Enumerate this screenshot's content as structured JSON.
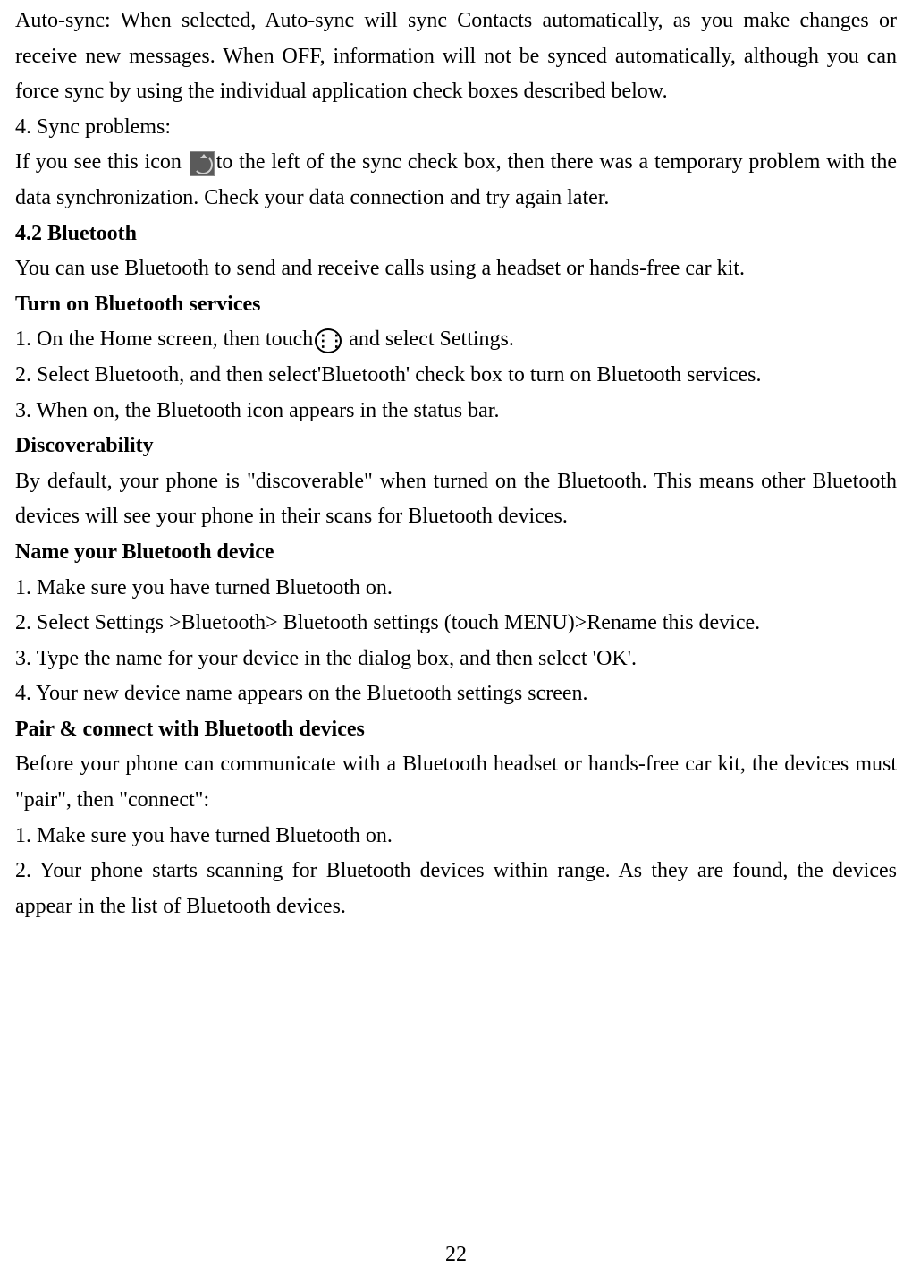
{
  "p1": "Auto-sync: When selected, Auto-sync will sync Contacts automatically, as you make changes or receive new messages. When OFF, information will not be synced automatically, although you can force sync by using the individual application check boxes described below.",
  "p2": "4. Sync problems:",
  "p3a": "If you see this icon ",
  "p3b": "to the left of the sync check box, then there was a temporary problem with the data synchronization. Check your data connection and try again later.",
  "h42": "4.2 Bluetooth",
  "p4": "You can use Bluetooth to send and receive calls using a headset or hands-free car kit.",
  "h_turn": "Turn on Bluetooth services",
  "p5a": "1. On the Home screen, then touch",
  "p5b": " and select Settings.",
  "p6": "2. Select Bluetooth, and then select'Bluetooth' check box to turn on Bluetooth services.",
  "p7": "3. When on, the Bluetooth icon appears in the status bar.",
  "h_disc": "Discoverability",
  "p8": "By default, your phone is \"discoverable\" when turned on the Bluetooth. This means other Bluetooth devices will see your phone in their scans for Bluetooth devices.",
  "h_name": "Name your Bluetooth device",
  "p9": "1. Make sure you have turned Bluetooth on.",
  "p10": "2. Select Settings >Bluetooth> Bluetooth settings (touch MENU)>Rename this device.",
  "p11": "3. Type the name for your device in the dialog box, and then select 'OK'.",
  "p12": "4. Your new device name appears on the Bluetooth settings screen.",
  "h_pair": "Pair & connect with Bluetooth devices",
  "p13": "Before your phone can communicate with a Bluetooth headset or hands-free car kit, the devices must \"pair\", then \"connect\":",
  "p14": "1. Make sure you have turned Bluetooth on.",
  "p15": "2. Your phone starts scanning for Bluetooth devices within range. As they are found, the devices appear in the list of Bluetooth devices.",
  "page_num": "22"
}
